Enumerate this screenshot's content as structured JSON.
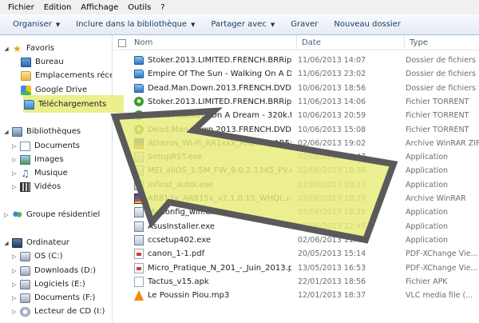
{
  "menu": [
    "Fichier",
    "Edition",
    "Affichage",
    "Outils",
    "?"
  ],
  "toolbar": {
    "organize": "Organiser",
    "include": "Inclure dans la bibliothèque",
    "share": "Partager avec",
    "burn": "Graver",
    "new_folder": "Nouveau dossier"
  },
  "nav": {
    "favorites": "Favoris",
    "desktop": "Bureau",
    "recent": "Emplacements récents",
    "gdrive": "Google Drive",
    "downloads": "Téléchargements",
    "libraries": "Bibliothèques",
    "documents": "Documents",
    "images": "Images",
    "music": "Musique",
    "videos": "Vidéos",
    "homegroup": "Groupe résidentiel",
    "computer": "Ordinateur",
    "drive_c": "OS (C:)",
    "drive_d": "Downloads (D:)",
    "drive_e": "Logiciels (E:)",
    "drive_f": "Documents (F:)",
    "drive_i": "Lecteur de CD (I:)"
  },
  "columns": {
    "name": "Nom",
    "date": "Date",
    "type": "Type"
  },
  "files": [
    {
      "name": "Stoker.2013.LIMITED.FRENCH.BRRip.Xvi...",
      "date": "11/06/2013 14:07",
      "type": "Dossier de fichiers",
      "icon": "folder-blue"
    },
    {
      "name": "Empire Of The Sun - Walking On A Dre...",
      "date": "11/06/2013 23:02",
      "type": "Dossier de fichiers",
      "icon": "folder-blue"
    },
    {
      "name": "Dead.Man.Down.2013.FRENCH.DVDRiP...",
      "date": "10/06/2013 18:56",
      "type": "Dossier de fichiers",
      "icon": "folder-blue"
    },
    {
      "name": "Stoker.2013.LIMITED.FRENCH.BRRip.Xvi...",
      "date": "11/06/2013 14:06",
      "type": "Fichier TORRENT",
      "icon": "torrent"
    },
    {
      "name": "(2008) Walking On A Dream - 320k.torr...",
      "date": "10/06/2013 20:59",
      "type": "Fichier TORRENT",
      "icon": "torrent"
    },
    {
      "name": "Dead.Man.Down.2013.FRENCH.DVDRiP...",
      "date": "10/06/2013 15:08",
      "type": "Fichier TORRENT",
      "icon": "torrent"
    },
    {
      "name": "Atheros_Wi-Fi_AR1xxx_AR2xxx_AR5xxx...",
      "date": "02/06/2013 19:02",
      "type": "Archive WinRAR ZIP",
      "icon": "rar"
    },
    {
      "name": "SetupRST.exe",
      "date": "02/06/2013 18:47",
      "type": "Application",
      "icon": "exe"
    },
    {
      "name": "MEI_allOS_1.5M_FW_9.0.2.1345_PV.exe",
      "date": "02/06/2013 18:36",
      "type": "Application",
      "icon": "exe"
    },
    {
      "name": "infinst_autol.exe",
      "date": "02/06/2013 18:33",
      "type": "Application",
      "icon": "exe"
    },
    {
      "name": "AR813x_AR815x_v2.1.0.15_WHQL.rar",
      "date": "02/06/2013 18:29",
      "type": "Archive WinRAR",
      "icon": "rar"
    },
    {
      "name": "MaConfig_win.exe",
      "date": "02/06/2013 18:28",
      "type": "Application",
      "icon": "exe"
    },
    {
      "name": "AsusInstaller.exe",
      "date": "02/06/2013 12:45",
      "type": "Application",
      "icon": "exe"
    },
    {
      "name": "ccsetup402.exe",
      "date": "02/06/2013 11:46",
      "type": "Application",
      "icon": "exe"
    },
    {
      "name": "canon_1-1.pdf",
      "date": "20/05/2013 15:14",
      "type": "PDF-XChange Vie...",
      "icon": "pdf"
    },
    {
      "name": "Micro_Pratique_N_201_-_Juin_2013.pdf",
      "date": "13/05/2013 16:53",
      "type": "PDF-XChange Vie...",
      "icon": "pdf"
    },
    {
      "name": "Tactus_v15.apk",
      "date": "22/01/2013 18:56",
      "type": "Fichier APK",
      "icon": "apk"
    },
    {
      "name": "Le Poussin Piou.mp3",
      "date": "12/01/2013 18:37",
      "type": "VLC media file (...",
      "icon": "vlc"
    }
  ],
  "colors": {
    "highlight": "#e8ec78",
    "arrow_border": "#5a5a5a"
  }
}
